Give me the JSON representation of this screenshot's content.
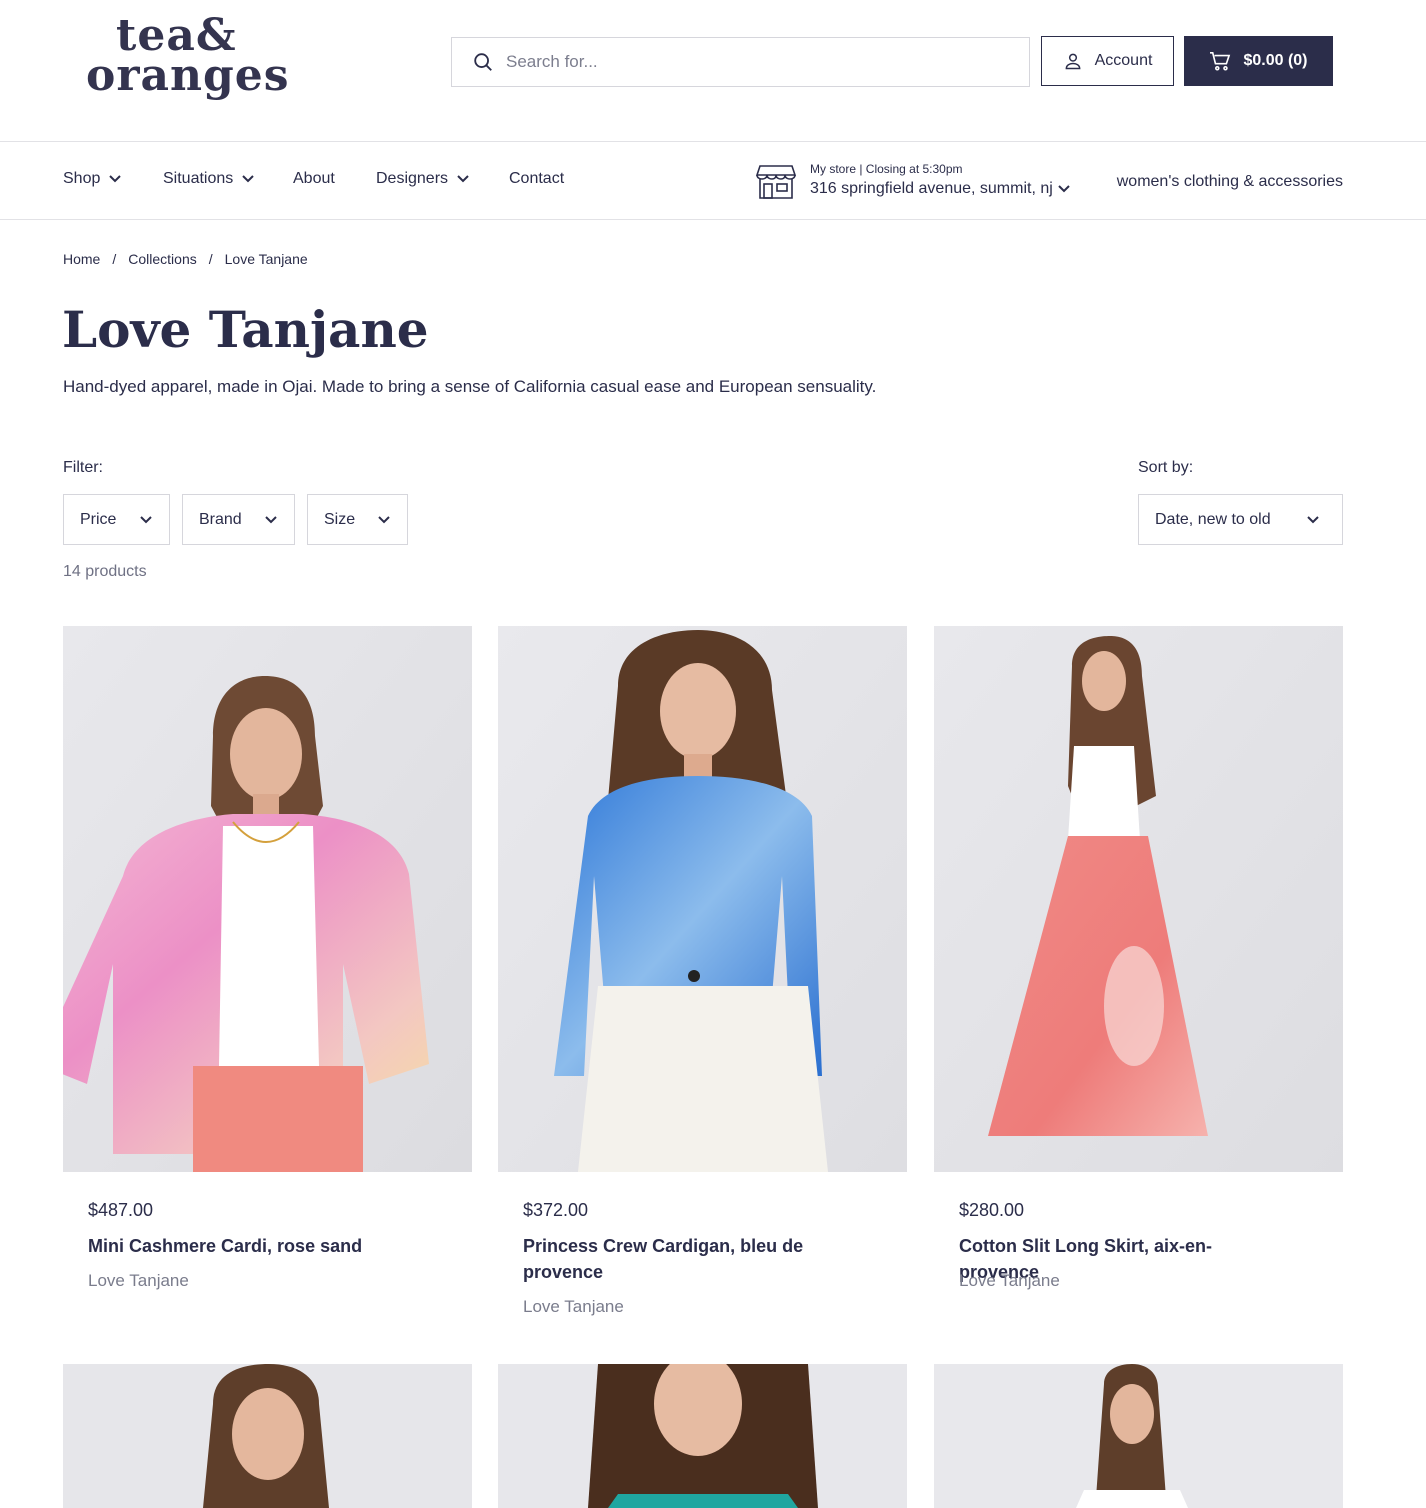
{
  "header": {
    "logo_line1": "tea&",
    "logo_line2": "oranges",
    "search_placeholder": "Search for...",
    "account_label": "Account",
    "cart_label": "$0.00 (0)"
  },
  "nav": {
    "items": [
      {
        "label": "Shop"
      },
      {
        "label": "Situations"
      },
      {
        "label": "About"
      },
      {
        "label": "Designers"
      },
      {
        "label": "Contact"
      }
    ],
    "store_meta": "My store  |  Closing at 5:30pm",
    "store_address": "316 springfield avenue, summit, nj",
    "tagline": "women's clothing & accessories"
  },
  "breadcrumb": {
    "items": [
      "Home",
      "Collections",
      "Love Tanjane"
    ],
    "separator": "/"
  },
  "collection": {
    "title": "Love Tanjane",
    "description": "Hand-dyed apparel, made in Ojai.  Made to bring a sense of California casual ease and European sensuality."
  },
  "filters": {
    "label": "Filter:",
    "options": [
      "Price",
      "Brand",
      "Size"
    ],
    "sort_label": "Sort by:",
    "sort_value": "Date, new to old",
    "count": "14 products"
  },
  "products": [
    {
      "price": "$487.00",
      "name": "Mini Cashmere Cardi, rose sand",
      "brand": "Love Tanjane"
    },
    {
      "price": "$372.00",
      "name": "Princess Crew Cardigan, bleu de provence",
      "brand": "Love Tanjane"
    },
    {
      "price": "$280.00",
      "name": "Cotton Slit Long Skirt, aix-en-provence",
      "brand": "Love Tanjane"
    }
  ],
  "colors": {
    "brand_navy": "#2b2d4a",
    "muted": "#7a7c8c",
    "border": "#d6d6dc"
  }
}
